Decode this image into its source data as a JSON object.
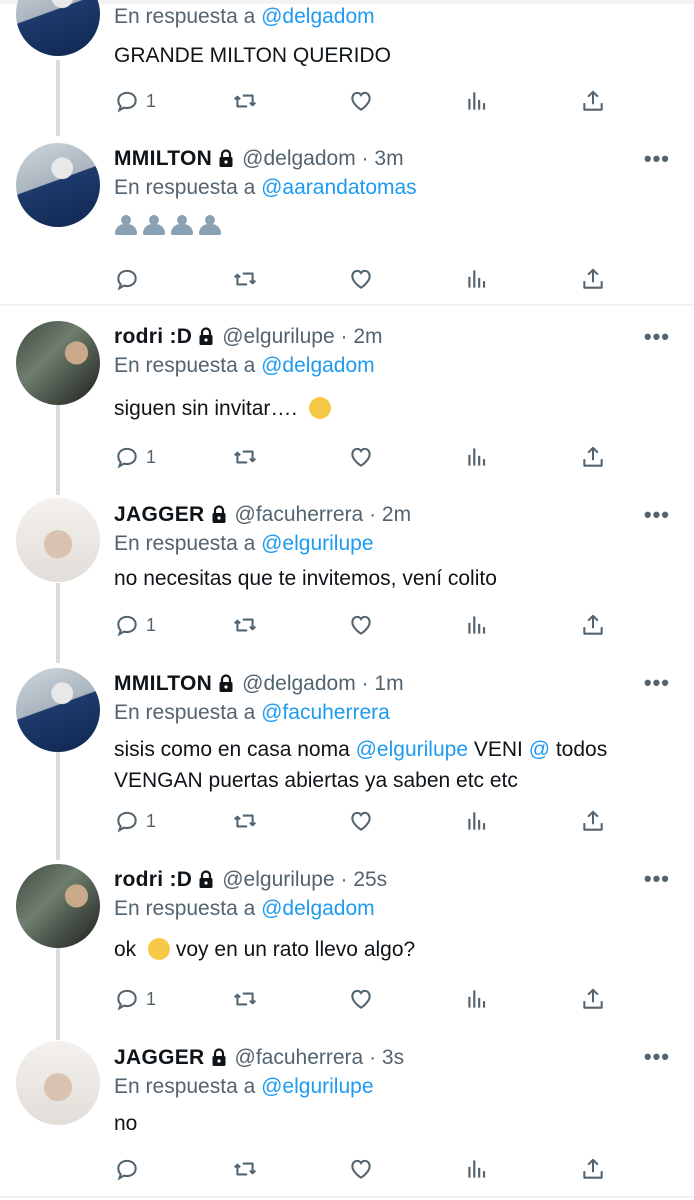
{
  "replying_prefix": "En respuesta a",
  "more_label": "•••",
  "colors": {
    "mention": "#1d9bf0",
    "secondary": "#536471",
    "text": "#0f1419"
  },
  "tweets": [
    {
      "name": "",
      "handle": "",
      "time": "",
      "reply_to": "@delgadom",
      "text": "GRANDE MILTON QUERIDO",
      "reply_count": "1"
    },
    {
      "name": "MMILTON",
      "handle": "@delgadom",
      "time": "3m",
      "reply_to": "@aarandatomas",
      "text": "",
      "emoji": "busts-in-silhouette x4",
      "reply_count": ""
    },
    {
      "name": "rodri :D",
      "handle": "@elgurilupe",
      "time": "2m",
      "reply_to": "@delgadom",
      "text": "siguen sin invitar….",
      "emoji": "pensive-face",
      "reply_count": "1"
    },
    {
      "name": "JAGGER",
      "handle": "@facuherrera",
      "time": "2m",
      "reply_to": "@elgurilupe",
      "text": "no necesitas que te invitemos, vení colito",
      "reply_count": "1"
    },
    {
      "name": "MMILTON",
      "handle": "@delgadom",
      "time": "1m",
      "reply_to": "@facuherrera",
      "text_parts": [
        "sisis como en casa noma ",
        "@elgurilupe",
        " VENI ",
        "@",
        " todos VENGAN puertas abiertas ya saben etc etc"
      ],
      "reply_count": "1"
    },
    {
      "name": "rodri :D",
      "handle": "@elgurilupe",
      "time": "25s",
      "reply_to": "@delgadom",
      "text_before": "ok",
      "text_after": "  voy en un rato llevo algo?",
      "emoji": "hugging-face",
      "reply_count": "1"
    },
    {
      "name": "JAGGER",
      "handle": "@facuherrera",
      "time": "3s",
      "reply_to": "@elgurilupe",
      "text": "no",
      "reply_count": ""
    }
  ]
}
